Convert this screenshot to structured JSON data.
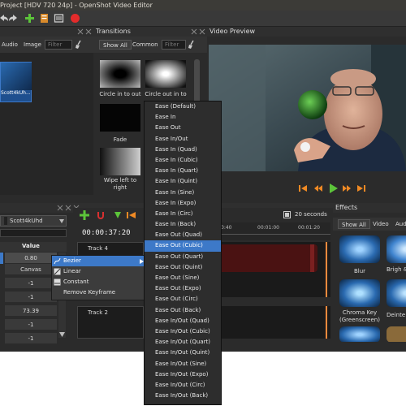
{
  "window": {
    "title": "Project [HDV 720 24p] - OpenShot Video Editor"
  },
  "files": {
    "tabs": [
      "Audio",
      "Image"
    ],
    "filter_placeholder": "Filter",
    "selected_file_label": "Scott4kUh..."
  },
  "transitions": {
    "title": "Transitions",
    "tabs": [
      "Show All",
      "Common"
    ],
    "filter_placeholder": "Filter",
    "items": [
      {
        "label": "Circle in to out"
      },
      {
        "label": "Circle out in to"
      },
      {
        "label": "Fade"
      },
      {
        "label": "Wipe left to right"
      }
    ]
  },
  "video_preview": {
    "title": "Video Preview"
  },
  "properties": {
    "clip_selector": "Scott4kUhd",
    "value_header": "Value",
    "values": [
      "0.80",
      "Canvas",
      "-1",
      "-1",
      "73.39",
      "-1",
      "-1"
    ]
  },
  "context_menu": {
    "items": [
      "Bezier",
      "Linear",
      "Constant",
      "Remove Keyframe"
    ]
  },
  "ease_menu": {
    "items": [
      "Ease (Default)",
      "Ease In",
      "Ease Out",
      "Ease In/Out",
      "Ease In (Quad)",
      "Ease In (Cubic)",
      "Ease In (Quart)",
      "Ease In (Quint)",
      "Ease In (Sine)",
      "Ease In (Expo)",
      "Ease In (Circ)",
      "Ease In (Back)",
      "Ease Out (Quad)",
      "Ease Out (Cubic)",
      "Ease Out (Quart)",
      "Ease Out (Quint)",
      "Ease Out (Sine)",
      "Ease Out (Expo)",
      "Ease Out (Circ)",
      "Ease Out (Back)",
      "Ease In/Out (Quad)",
      "Ease In/Out (Cubic)",
      "Ease In/Out (Quart)",
      "Ease In/Out (Quint)",
      "Ease In/Out (Sine)",
      "Ease In/Out (Expo)",
      "Ease In/Out (Circ)",
      "Ease In/Out (Back)"
    ],
    "highlighted": "Ease Out (Cubic)"
  },
  "timeline": {
    "timecode": "00:00:37:20",
    "zoom_label": "20 seconds",
    "ruler_labels": [
      "0:40",
      "00:01:00",
      "00:01:20"
    ],
    "tracks": [
      "Track 4",
      "Track 2"
    ]
  },
  "effects": {
    "title": "Effects",
    "tabs": [
      "Show All",
      "Video",
      "Aud"
    ],
    "items": [
      {
        "label": "Blur"
      },
      {
        "label": "Brigh & Con"
      },
      {
        "label": "Chroma Key (Greenscreen)"
      },
      {
        "label": "Deinte"
      }
    ]
  },
  "colors": {
    "selection": "#3d79c8",
    "panel_bg": "#2b2b2b",
    "playhead": "#ff8a3d"
  }
}
